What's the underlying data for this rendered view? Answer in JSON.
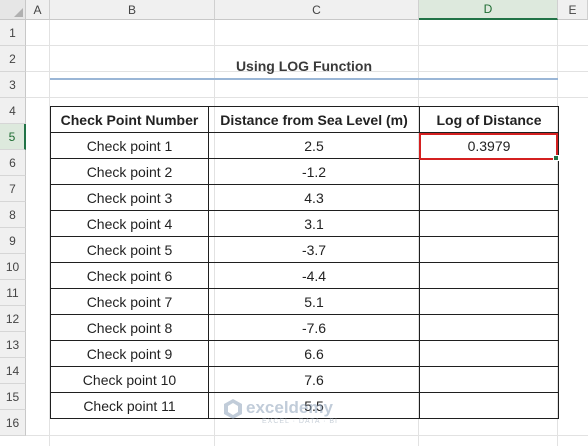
{
  "columns": [
    "A",
    "B",
    "C",
    "D",
    "E"
  ],
  "rows": [
    "1",
    "2",
    "3",
    "4",
    "5",
    "6",
    "7",
    "8",
    "9",
    "10",
    "11",
    "12",
    "13",
    "14",
    "15",
    "16"
  ],
  "selected_column": "D",
  "selected_row": "5",
  "title": "Using LOG Function",
  "table": {
    "headers": [
      "Check Point Number",
      "Distance from Sea Level (m)",
      "Log of Distance"
    ],
    "rows": [
      [
        "Check point 1",
        "2.5",
        "0.3979"
      ],
      [
        "Check point 2",
        "-1.2",
        ""
      ],
      [
        "Check point 3",
        "4.3",
        ""
      ],
      [
        "Check point 4",
        "3.1",
        ""
      ],
      [
        "Check point 5",
        "-3.7",
        ""
      ],
      [
        "Check point 6",
        "-4.4",
        ""
      ],
      [
        "Check point 7",
        "5.1",
        ""
      ],
      [
        "Check point 8",
        "-7.6",
        ""
      ],
      [
        "Check point 9",
        "6.6",
        ""
      ],
      [
        "Check point 10",
        "7.6",
        ""
      ],
      [
        "Check point 11",
        "5.5",
        ""
      ]
    ]
  },
  "watermark": {
    "name": "exceldemy",
    "tagline": "EXCEL · DATA · BI"
  },
  "colors": {
    "accent": "#217346",
    "highlight": "#d42020",
    "title_rule": "#9ab6d6"
  }
}
